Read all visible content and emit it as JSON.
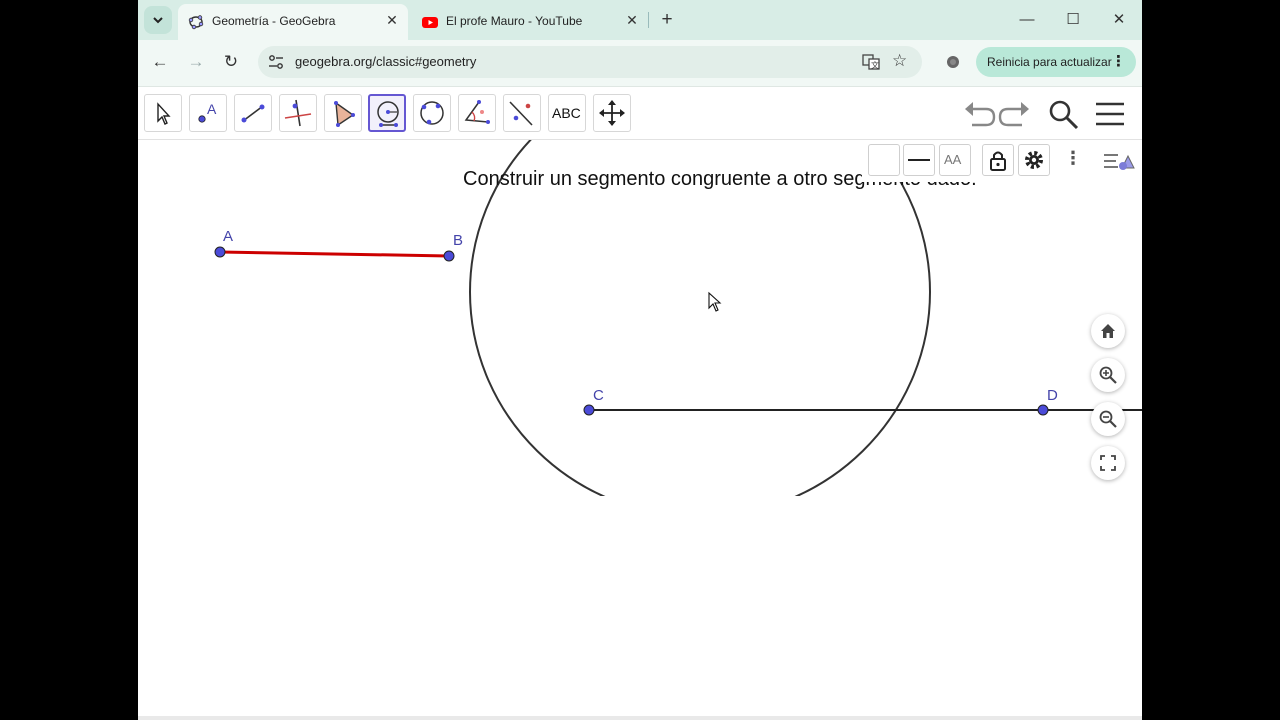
{
  "browser": {
    "tabs": [
      {
        "title": "Geometría - GeoGebra",
        "icon": "geogebra-icon",
        "active": true
      },
      {
        "title": "El profe Mauro - YouTube",
        "icon": "youtube-icon",
        "active": false
      }
    ],
    "new_tab_symbol": "+",
    "url": "geogebra.org/classic#geometry",
    "restart_label": "Reinicia para actualizar",
    "colors": {
      "tabstrip": "#d8ede6",
      "toolbar": "#f1f8f5",
      "restart_button": "#b9e8d8"
    }
  },
  "ggb_toolbar": {
    "tools": [
      "move-tool",
      "point-tool",
      "segment-tool",
      "perpendicular-line-tool",
      "polygon-tool",
      "compass-tool",
      "circle-through-points-tool",
      "angle-tool",
      "reflect-tool",
      "text-tool",
      "move-graphics-view-tool"
    ],
    "selected_tool": "compass-tool",
    "text_tool_label": "ABC",
    "style_bar": {
      "text_style_label": "AA"
    }
  },
  "canvas": {
    "heading": "Construir un segmento congruente a otro segmento dado.",
    "points": [
      {
        "label": "A"
      },
      {
        "label": "B"
      },
      {
        "label": "C"
      },
      {
        "label": "D"
      }
    ],
    "segments": [
      {
        "name": "AB",
        "color": "#cc0000"
      },
      {
        "name": "CD",
        "color": "#222222"
      }
    ],
    "point_color": "#4b4bd8"
  }
}
